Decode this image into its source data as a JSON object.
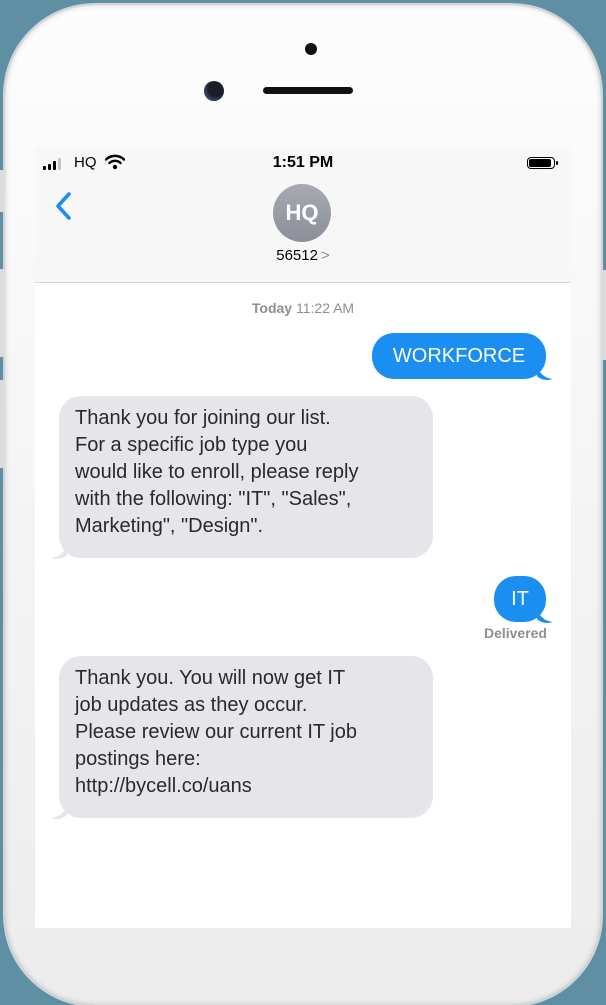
{
  "status_bar": {
    "carrier": "HQ",
    "time": "1:51 PM"
  },
  "header": {
    "avatar_initials": "HQ",
    "contact_number": "56512",
    "contact_chevron": ">"
  },
  "conversation": {
    "timestamp_day": "Today",
    "timestamp_time": "11:22 AM",
    "messages": [
      {
        "direction": "outgoing",
        "text": "WORKFORCE"
      },
      {
        "direction": "incoming",
        "text": "Thank you for joining our list.\nFor a specific job type you\nwould like to enroll, please reply\nwith the following: \"IT\", \"Sales\",\nMarketing\", \"Design\"."
      },
      {
        "direction": "outgoing",
        "text": "IT"
      },
      {
        "direction": "incoming",
        "text": "Thank you. You will now get IT\njob updates as they occur.\nPlease review our current IT job\npostings here:\nhttp://bycell.co/uans"
      }
    ],
    "delivery_status": "Delivered"
  },
  "colors": {
    "outgoing_bubble": "#1b8ef2",
    "incoming_bubble": "#e5e5ea",
    "back_arrow": "#1b8ef2",
    "background": "#5f8fa3"
  },
  "icons": [
    "signal-icon",
    "wifi-icon",
    "battery-icon",
    "back-chevron-icon",
    "contact-chevron-icon"
  ]
}
